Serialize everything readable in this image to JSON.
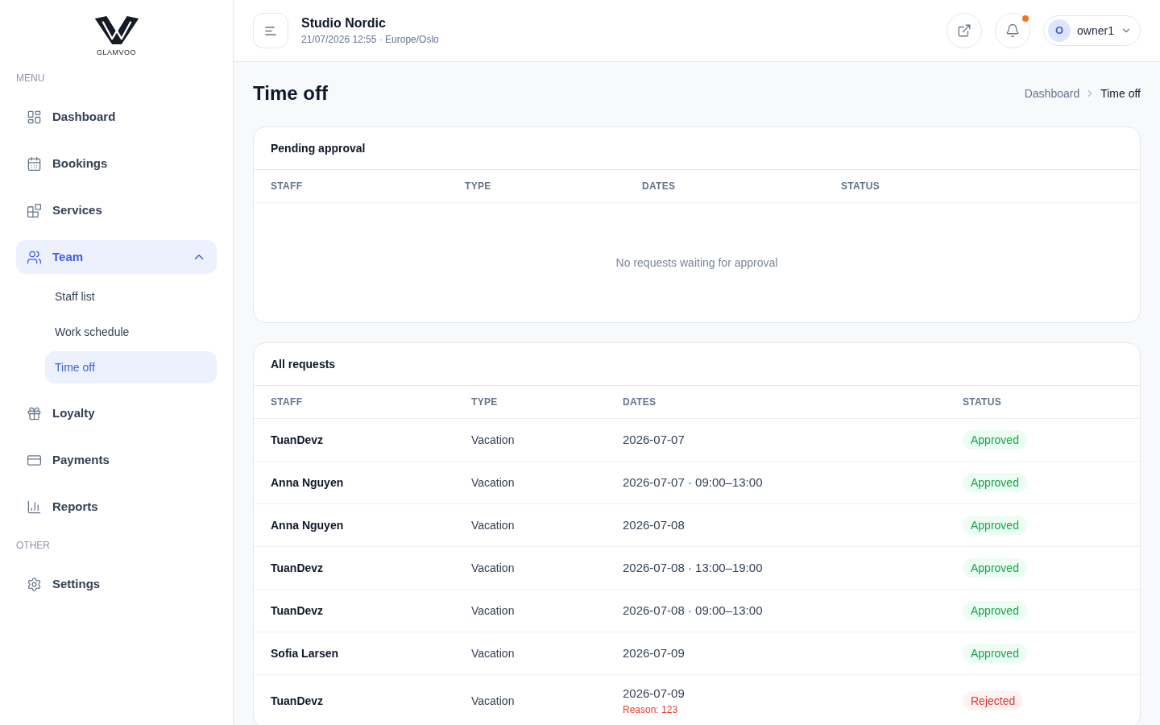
{
  "sidebar": {
    "logo": {
      "text": "GLAMVOO"
    },
    "sections": [
      {
        "heading": "MENU",
        "items": [
          {
            "label": "Dashboard",
            "selected": false
          },
          {
            "label": "Bookings",
            "selected": false
          },
          {
            "label": "Services",
            "selected": false
          },
          {
            "label": "Team",
            "selected": true,
            "expanded": true,
            "children": [
              {
                "label": "Staff list",
                "selected": false
              },
              {
                "label": "Work schedule",
                "selected": false
              },
              {
                "label": "Time off",
                "selected": true
              }
            ]
          },
          {
            "label": "Loyalty",
            "selected": false
          },
          {
            "label": "Payments",
            "selected": false
          },
          {
            "label": "Reports",
            "selected": false
          }
        ]
      },
      {
        "heading": "OTHER",
        "items": [
          {
            "label": "Settings",
            "selected": false
          }
        ]
      }
    ]
  },
  "header": {
    "title": "Studio Nordic",
    "subtitle": "21/07/2026 12:55 · Europe/Oslo",
    "notifications": {
      "unread": true
    },
    "user": {
      "initial": "O",
      "name": "owner1"
    }
  },
  "page": {
    "title": "Time off",
    "breadcrumb": [
      {
        "label": "Dashboard",
        "current": false
      },
      {
        "label": "Time off",
        "current": true
      }
    ]
  },
  "pending": {
    "title": "Pending approval",
    "columns": [
      "STAFF",
      "TYPE",
      "DATES",
      "STATUS"
    ],
    "empty_message": "No requests waiting for approval"
  },
  "all_requests": {
    "title": "All requests",
    "columns": [
      "STAFF",
      "TYPE",
      "DATES",
      "STATUS"
    ],
    "rows": [
      {
        "staff": "TuanDevz",
        "type": "Vacation",
        "dates": "2026-07-07",
        "status": {
          "label": "Approved",
          "kind": "approved"
        }
      },
      {
        "staff": "Anna Nguyen",
        "type": "Vacation",
        "dates": "2026-07-07 · 09:00–13:00",
        "status": {
          "label": "Approved",
          "kind": "approved"
        }
      },
      {
        "staff": "Anna Nguyen",
        "type": "Vacation",
        "dates": "2026-07-08",
        "status": {
          "label": "Approved",
          "kind": "approved"
        }
      },
      {
        "staff": "TuanDevz",
        "type": "Vacation",
        "dates": "2026-07-08 · 13:00–19:00",
        "status": {
          "label": "Approved",
          "kind": "approved"
        }
      },
      {
        "staff": "TuanDevz",
        "type": "Vacation",
        "dates": "2026-07-08 · 09:00–13:00",
        "status": {
          "label": "Approved",
          "kind": "approved"
        }
      },
      {
        "staff": "Sofia Larsen",
        "type": "Vacation",
        "dates": "2026-07-09",
        "status": {
          "label": "Approved",
          "kind": "approved"
        }
      },
      {
        "staff": "TuanDevz",
        "type": "Vacation",
        "dates": "2026-07-09",
        "reason": "Reason: 123",
        "status": {
          "label": "Rejected",
          "kind": "rejected"
        }
      }
    ]
  }
}
